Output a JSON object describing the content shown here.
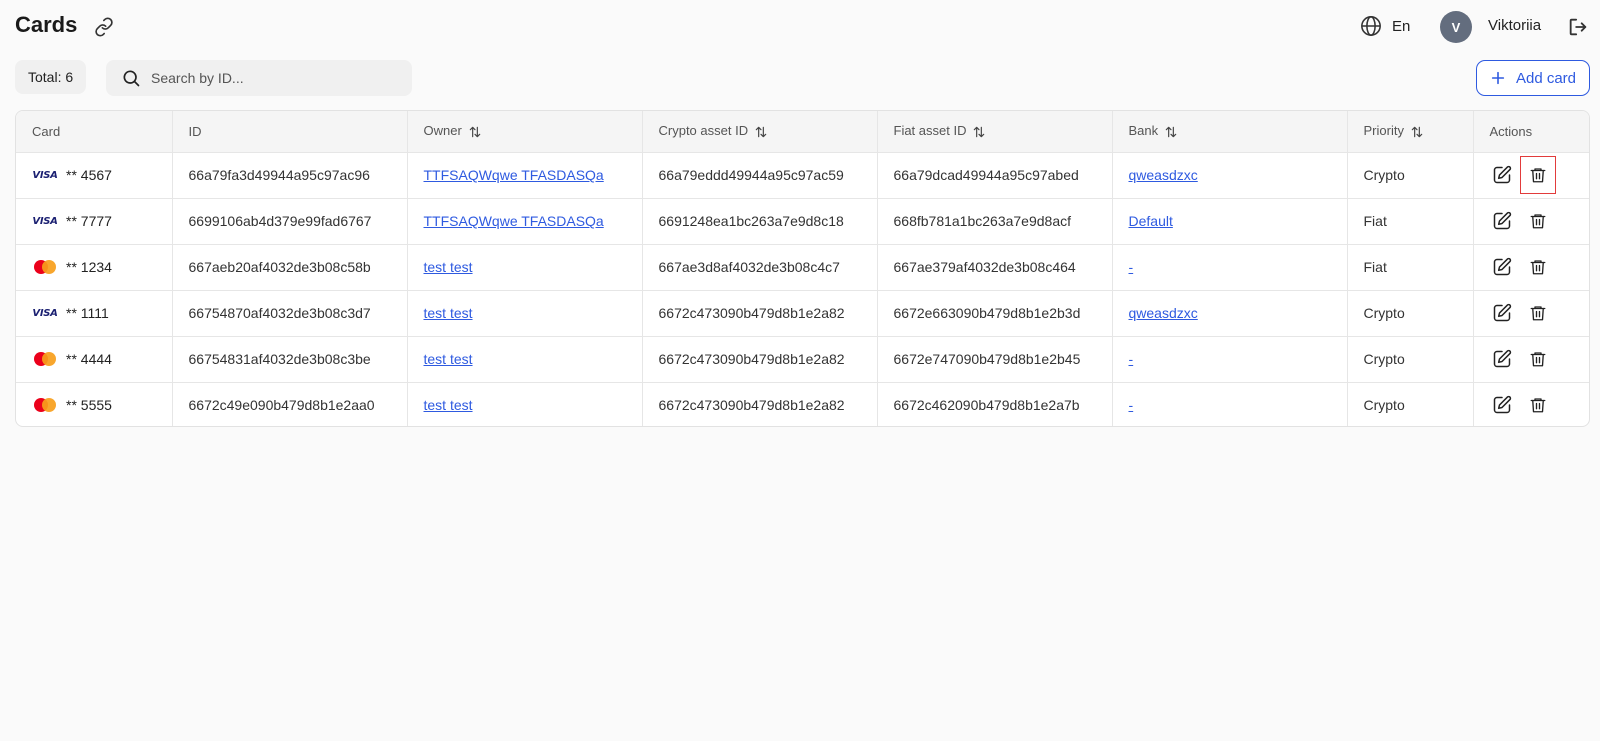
{
  "header": {
    "title": "Cards",
    "language": "En",
    "avatar_initial": "V",
    "username": "Viktoriia"
  },
  "toolbar": {
    "total_label": "Total: 6",
    "search_placeholder": "Search by ID...",
    "add_label": "Add card"
  },
  "table": {
    "columns": {
      "card": "Card",
      "id": "ID",
      "owner": "Owner",
      "crypto": "Crypto asset ID",
      "fiat": "Fiat asset ID",
      "bank": "Bank",
      "priority": "Priority",
      "actions": "Actions"
    },
    "rows": [
      {
        "brand": "visa",
        "brand_text": "VISA",
        "number": "** 4567",
        "id": "66a79fa3d49944a95c97ac96",
        "owner": "TTFSAQWqwe TFASDASQa",
        "crypto": "66a79eddd49944a95c97ac59",
        "fiat": "66a79dcad49944a95c97abed",
        "bank": "qweasdzxc",
        "priority": "Crypto"
      },
      {
        "brand": "visa",
        "brand_text": "VISA",
        "number": "** 7777",
        "id": "6699106ab4d379e99fad6767",
        "owner": "TTFSAQWqwe TFASDASQa",
        "crypto": "6691248ea1bc263a7e9d8c18",
        "fiat": "668fb781a1bc263a7e9d8acf",
        "bank": "Default",
        "priority": "Fiat"
      },
      {
        "brand": "mastercard",
        "brand_text": "",
        "number": "** 1234",
        "id": "667aeb20af4032de3b08c58b",
        "owner": "test test",
        "crypto": "667ae3d8af4032de3b08c4c7",
        "fiat": "667ae379af4032de3b08c464",
        "bank": "-",
        "priority": "Fiat"
      },
      {
        "brand": "visa",
        "brand_text": "VISA",
        "number": "** 1111",
        "id": "66754870af4032de3b08c3d7",
        "owner": "test test",
        "crypto": "6672c473090b479d8b1e2a82",
        "fiat": "6672e663090b479d8b1e2b3d",
        "bank": "qweasdzxc",
        "priority": "Crypto"
      },
      {
        "brand": "mastercard",
        "brand_text": "",
        "number": "** 4444",
        "id": "66754831af4032de3b08c3be",
        "owner": "test test",
        "crypto": "6672c473090b479d8b1e2a82",
        "fiat": "6672e747090b479d8b1e2b45",
        "bank": "-",
        "priority": "Crypto"
      },
      {
        "brand": "mastercard",
        "brand_text": "",
        "number": "** 5555",
        "id": "6672c49e090b479d8b1e2aa0",
        "owner": "test test",
        "crypto": "6672c473090b479d8b1e2a82",
        "fiat": "6672c462090b479d8b1e2a7b",
        "bank": "-",
        "priority": "Crypto"
      }
    ]
  },
  "icons": {
    "link": "link-icon",
    "globe": "globe-icon",
    "logout": "logout-icon",
    "search": "search-icon",
    "plus": "plus-icon",
    "sort": "sort-icon",
    "edit": "edit-icon",
    "delete": "trash-icon"
  },
  "colors": {
    "accent": "#2e5ae0",
    "highlight": "#e23b3b",
    "avatar": "#636d7e"
  }
}
